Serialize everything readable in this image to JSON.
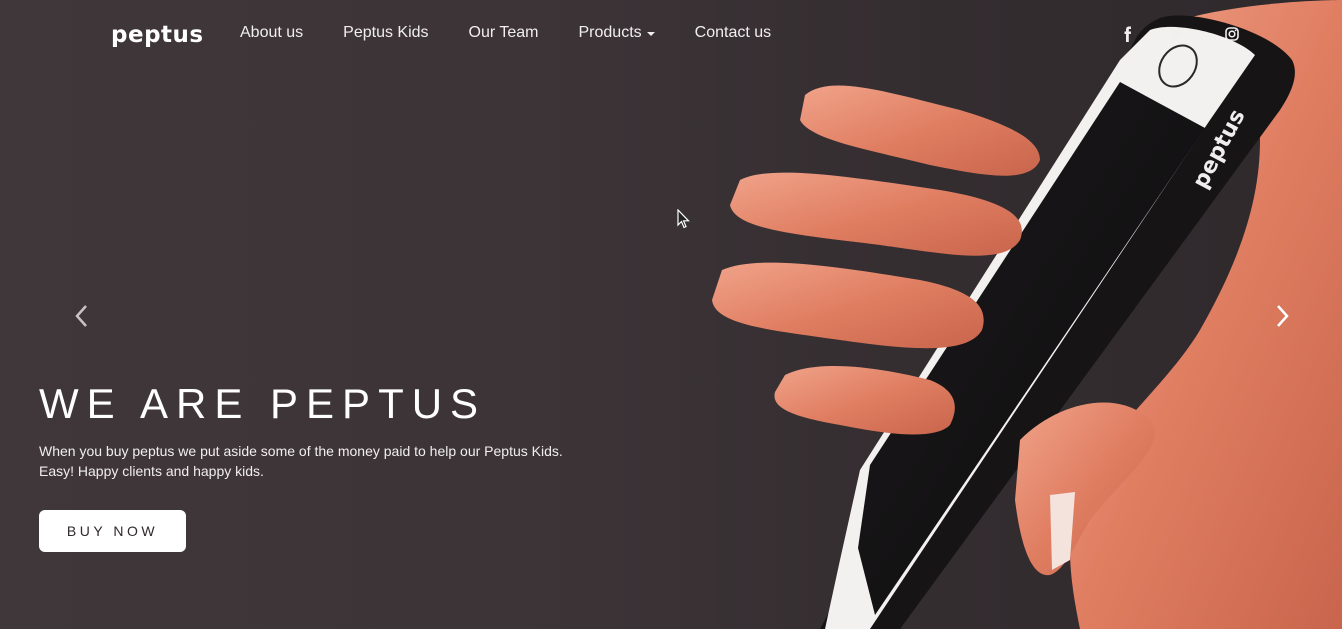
{
  "brand": {
    "logo_text": "peptus"
  },
  "nav": {
    "items": [
      {
        "label": "About us"
      },
      {
        "label": "Peptus Kids"
      },
      {
        "label": "Our Team"
      },
      {
        "label": "Products",
        "has_dropdown": true
      },
      {
        "label": "Contact us"
      }
    ]
  },
  "social": {
    "icons": [
      "facebook-icon",
      "twitter-icon",
      "instagram-icon"
    ]
  },
  "hero": {
    "headline": "WE ARE PEPTUS",
    "description_line1": "When you buy peptus we put aside some of the money paid to help our Peptus Kids.",
    "description_line2": "Easy! Happy clients and happy kids.",
    "cta_label": "BUY NOW",
    "phone_brand_text": "peptus"
  },
  "carousel": {
    "prev_icon": "chevron-left-icon",
    "next_icon": "chevron-right-icon"
  },
  "colors": {
    "background": "#3d3538",
    "text": "#ffffff",
    "button_bg": "#ffffff",
    "button_text": "#2f292c",
    "skin": "#e8866c"
  }
}
